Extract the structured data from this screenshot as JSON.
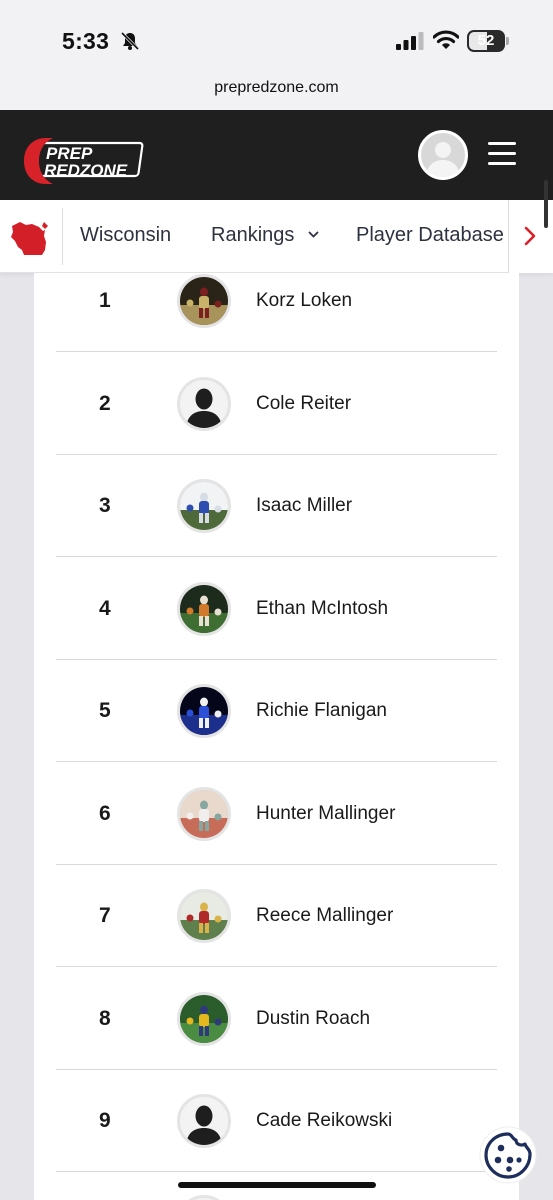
{
  "status_bar": {
    "time": "5:33",
    "battery": "52",
    "icons": [
      "bell-slash-icon",
      "cellular-signal-icon",
      "wifi-icon",
      "battery-icon"
    ]
  },
  "browser": {
    "url": "prepredzone.com"
  },
  "header": {
    "logo_top": "PREP",
    "logo_bottom": "REDZONE",
    "brand_color": "#d8222a",
    "icons": [
      "user-avatar-icon",
      "hamburger-menu-icon"
    ]
  },
  "nav": {
    "state_icon": "wisconsin-map-icon",
    "items": [
      {
        "label": "Wisconsin"
      },
      {
        "label": "Rankings",
        "has_dropdown": true
      },
      {
        "label": "Player Database"
      }
    ],
    "more_icon": "chevron-right-icon"
  },
  "rankings": [
    {
      "rank": "1",
      "name": "Korz Loken",
      "photo": "action"
    },
    {
      "rank": "2",
      "name": "Cole Reiter",
      "photo": "placeholder"
    },
    {
      "rank": "3",
      "name": "Isaac Miller",
      "photo": "action"
    },
    {
      "rank": "4",
      "name": "Ethan McIntosh",
      "photo": "action"
    },
    {
      "rank": "5",
      "name": "Richie Flanigan",
      "photo": "action"
    },
    {
      "rank": "6",
      "name": "Hunter Mallinger",
      "photo": "action"
    },
    {
      "rank": "7",
      "name": "Reece Mallinger",
      "photo": "action"
    },
    {
      "rank": "8",
      "name": "Dustin Roach",
      "photo": "action"
    },
    {
      "rank": "9",
      "name": "Cade Reikowski",
      "photo": "placeholder"
    }
  ],
  "cookie_icon": "cookie-settings-icon"
}
